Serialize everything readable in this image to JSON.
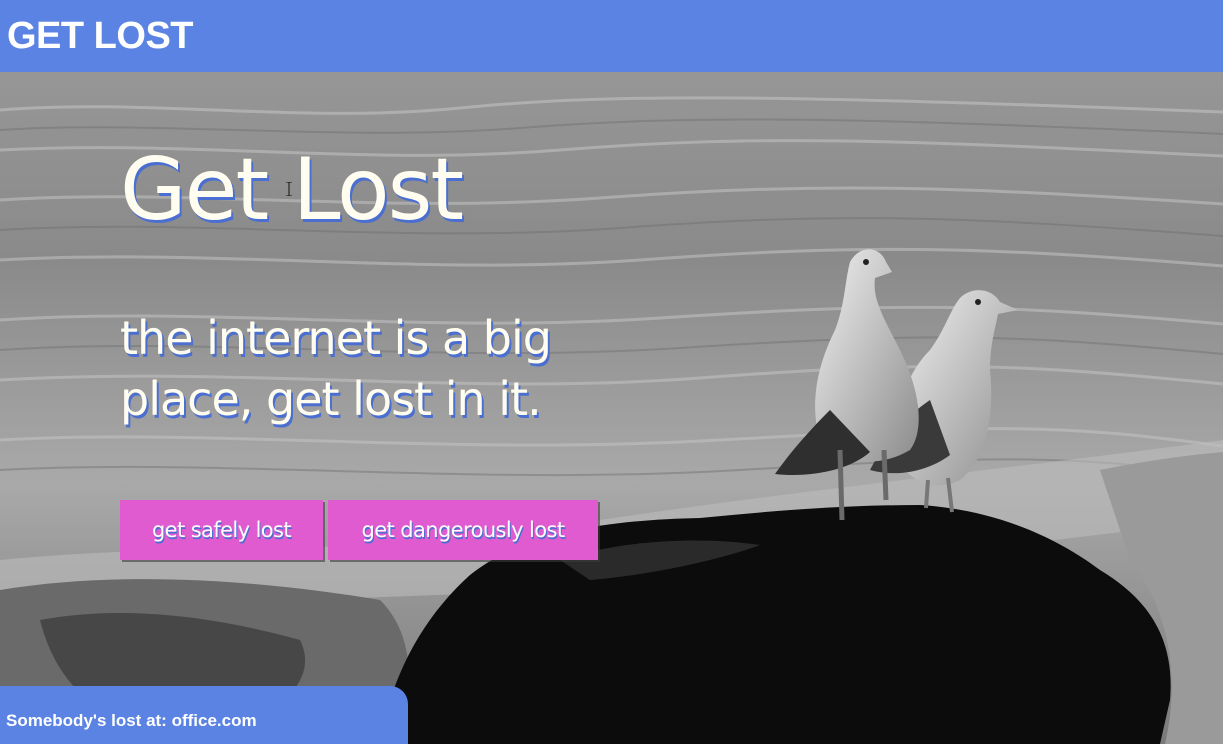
{
  "header": {
    "brand": "GET LOST"
  },
  "hero": {
    "title": "Get Lost",
    "subtitle": "the internet is a big place, get lost in it.",
    "background_image": "grayscale photo of two seagulls standing on a dark rock by the sea"
  },
  "buttons": {
    "safe_label": "get safely lost",
    "danger_label": "get dangerously lost"
  },
  "ticker": {
    "prefix": "Somebody's lost at:",
    "site": "office.com"
  },
  "colors": {
    "header_bg": "#5b83e4",
    "button_bg": "#e05bcf",
    "text_shadow": "#4a6fd0",
    "hero_text": "#fffdf0"
  },
  "icons": {
    "cursor": "text-cursor-icon"
  }
}
